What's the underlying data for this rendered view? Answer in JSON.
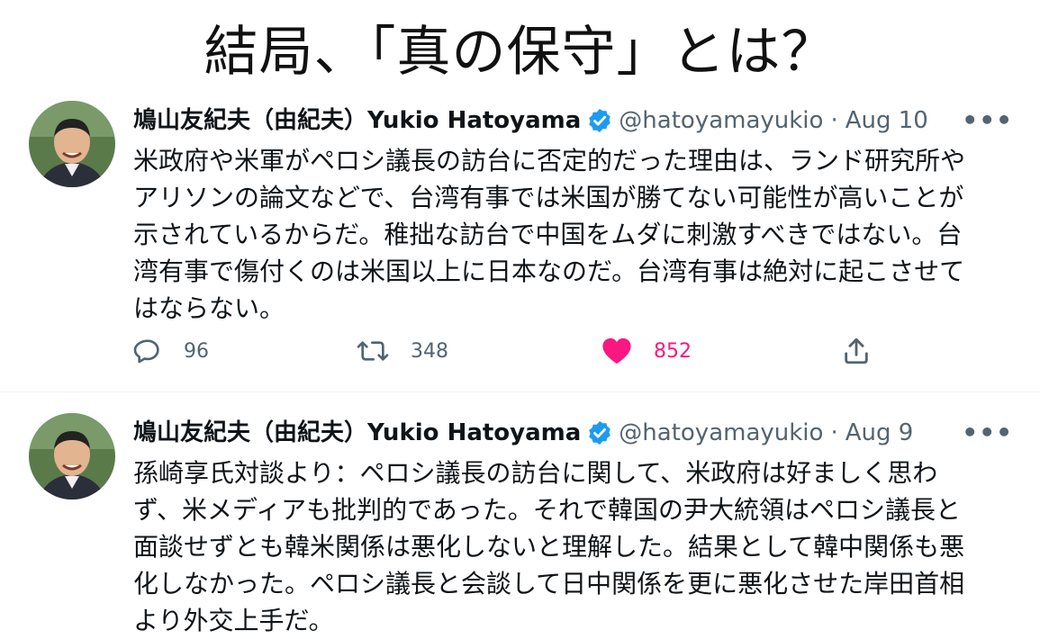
{
  "headline": "結局、「真の保守」とは？",
  "colors": {
    "verified": "#1d9bf0",
    "like": "#f91880",
    "secondary": "#536471"
  },
  "tweets": [
    {
      "name": "鳩山友紀夫（由紀夫）Yukio Hatoyama",
      "handle": "@hatoyamayukio",
      "separator": "·",
      "date": "Aug 10",
      "more": "•••",
      "text": "米政府や米軍がペロシ議長の訪台に否定的だった理由は、ランド研究所や\nアリソンの論文などで、台湾有事では米国が勝てない可能性が高いことが\n示されているからだ。稚拙な訪台で中国をムダに刺激すべきではない。台\n湾有事で傷付くのは米国以上に日本なのだ。台湾有事は絶対に起こさせて\nはならない。",
      "replies": "96",
      "retweets": "348",
      "likes": "852",
      "icons": {
        "reply": "reply-icon",
        "retweet": "retweet-icon",
        "like": "heart-filled-icon",
        "share": "share-icon"
      }
    },
    {
      "name": "鳩山友紀夫（由紀夫）Yukio Hatoyama",
      "handle": "@hatoyamayukio",
      "separator": "·",
      "date": "Aug 9",
      "more": "•••",
      "text": "孫崎享氏対談より：ペロシ議長の訪台に関して、米政府は好ましく思わ\nず、米メディアも批判的であった。それで韓国の尹大統領はペロシ議長と\n面談せずとも韓米関係は悪化しないと理解した。結果として韓中関係も悪\n化しなかった。ペロシ議長と会談して日中関係を更に悪化させた岸田首相\nより外交上手だ。"
    }
  ]
}
